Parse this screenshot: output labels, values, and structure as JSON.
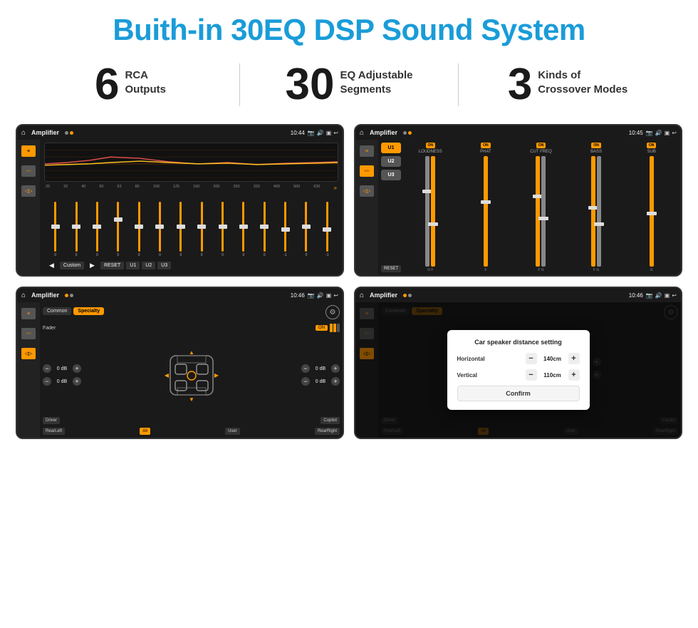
{
  "header": {
    "title": "Buith-in 30EQ DSP Sound System"
  },
  "stats": [
    {
      "number": "6",
      "label_line1": "RCA",
      "label_line2": "Outputs"
    },
    {
      "number": "30",
      "label_line1": "EQ Adjustable",
      "label_line2": "Segments"
    },
    {
      "number": "3",
      "label_line1": "Kinds of",
      "label_line2": "Crossover Modes"
    }
  ],
  "screens": [
    {
      "id": "eq-screen",
      "topbar": {
        "title": "Amplifier",
        "time": "10:44"
      },
      "type": "eq",
      "frequencies": [
        "25",
        "32",
        "40",
        "50",
        "63",
        "80",
        "100",
        "125",
        "160",
        "200",
        "250",
        "320",
        "400",
        "500",
        "630"
      ],
      "values": [
        "0",
        "0",
        "0",
        "5",
        "0",
        "0",
        "0",
        "0",
        "0",
        "0",
        "0",
        "-1",
        "0",
        "-1",
        ""
      ],
      "preset": "Custom",
      "buttons": [
        "RESET",
        "U1",
        "U2",
        "U3"
      ]
    },
    {
      "id": "crossover-screen",
      "topbar": {
        "title": "Amplifier",
        "time": "10:45"
      },
      "type": "crossover",
      "presets": [
        "U1",
        "U2",
        "U3"
      ],
      "channels": [
        {
          "name": "LOUDNESS",
          "on": true
        },
        {
          "name": "PHAT",
          "on": true
        },
        {
          "name": "CUT FREQ",
          "on": true
        },
        {
          "name": "BASS",
          "on": true
        },
        {
          "name": "SUB",
          "on": true
        }
      ],
      "resetBtn": "RESET"
    },
    {
      "id": "fader-screen",
      "topbar": {
        "title": "Amplifier",
        "time": "10:46"
      },
      "type": "fader",
      "tabs": [
        "Common",
        "Specialty"
      ],
      "activeTab": "Specialty",
      "faderLabel": "Fader",
      "faderOn": "ON",
      "volumes": [
        {
          "label": "0 dB"
        },
        {
          "label": "0 dB"
        },
        {
          "label": "0 dB"
        },
        {
          "label": "0 dB"
        }
      ],
      "bottomLabels": [
        "Driver",
        "",
        "Copilot",
        "RearLeft",
        "All",
        "",
        "User",
        "RearRight"
      ]
    },
    {
      "id": "dialog-screen",
      "topbar": {
        "title": "Amplifier",
        "time": "10:46"
      },
      "type": "dialog",
      "tabs": [
        "Common",
        "Specialty"
      ],
      "dialog": {
        "title": "Car speaker distance setting",
        "rows": [
          {
            "label": "Horizontal",
            "value": "140cm"
          },
          {
            "label": "Vertical",
            "value": "110cm"
          }
        ],
        "confirmLabel": "Confirm"
      }
    }
  ]
}
